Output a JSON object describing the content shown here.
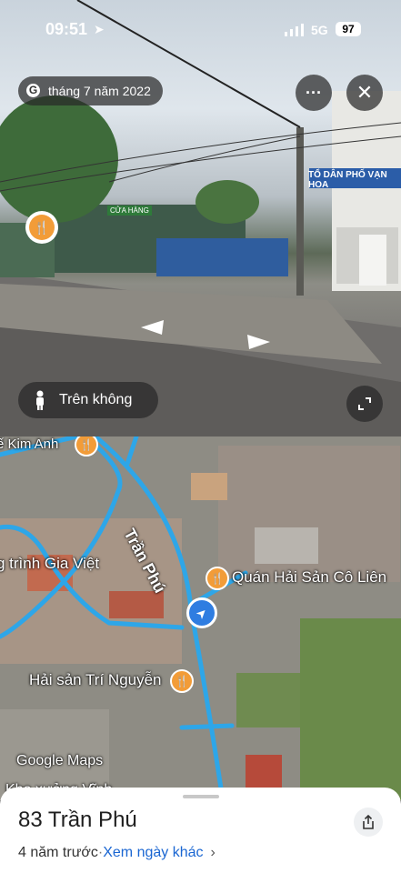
{
  "status_bar": {
    "time": "09:51",
    "network": "5G",
    "battery": "97"
  },
  "streetview": {
    "date_label": "tháng 7 năm 2022",
    "view_mode_label": "Trên không",
    "sign_text": "TỔ DÂN PHỐ VẠN HOA",
    "shop_sign": "CỬA HÀNG"
  },
  "map": {
    "labels": {
      "street": "Trần Phú",
      "kim_anh": "ế Kim Anh",
      "gia_viet": "g trình Gia Việt",
      "quan_hai_san": "Quán Hải Sản Cô Liên",
      "hai_san_tri": "Hải sản Trí Nguyễn",
      "bottom_partial": "Kho xưởng Vĩnh"
    },
    "watermark": "Google Maps"
  },
  "sheet": {
    "address": "83 Trần Phú",
    "age": "4 năm trước",
    "separator": "·",
    "other_dates": "Xem ngày khác",
    "chevron": "›"
  },
  "colors": {
    "road": "#2ea6e8",
    "poi": "#f29c38"
  }
}
